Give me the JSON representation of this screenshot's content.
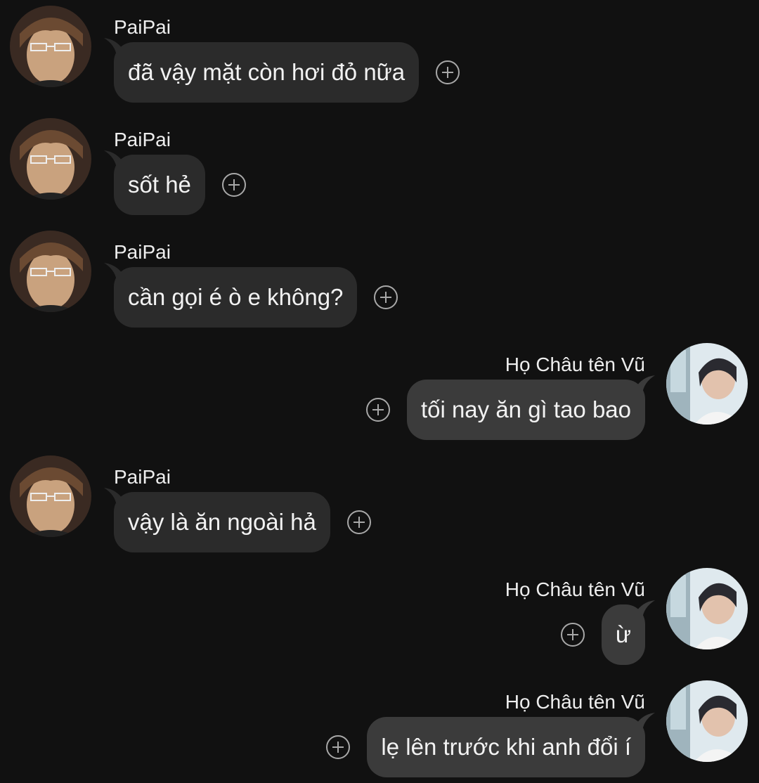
{
  "messages": [
    {
      "sender": "PaiPai",
      "text": "đã vậy mặt còn hơi đỏ nữa",
      "direction": "incoming"
    },
    {
      "sender": "PaiPai",
      "text": "sốt hẻ",
      "direction": "incoming"
    },
    {
      "sender": "PaiPai",
      "text": "cần gọi é ò e không?",
      "direction": "incoming"
    },
    {
      "sender": "Họ Châu tên Vũ",
      "text": "tối nay ăn gì tao bao",
      "direction": "outgoing"
    },
    {
      "sender": "PaiPai",
      "text": "vậy là ăn ngoài hả",
      "direction": "incoming"
    },
    {
      "sender": "Họ Châu tên Vũ",
      "text": "ừ",
      "direction": "outgoing"
    },
    {
      "sender": "Họ Châu tên Vũ",
      "text": "lẹ lên trước khi anh đổi í",
      "direction": "outgoing"
    }
  ],
  "icons": {
    "reaction": "add-reaction-icon",
    "avatar_incoming": "avatar-paipai",
    "avatar_outgoing": "avatar-ho-chau-ten-vu"
  },
  "colors": {
    "background": "#111111",
    "incoming_bubble": "#2b2b2b",
    "outgoing_bubble": "#3b3b3b",
    "text": "#f2f2f2",
    "icon": "#a8a8a8"
  }
}
